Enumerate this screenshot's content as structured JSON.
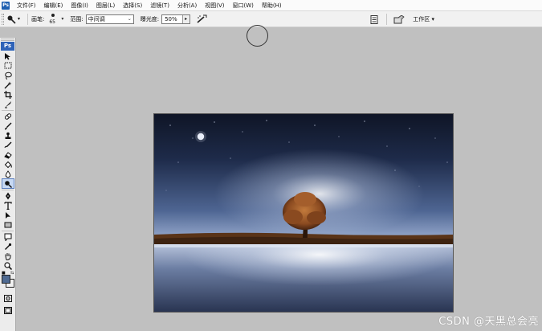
{
  "menubar": {
    "app_icon": "ps-app-icon",
    "items": [
      "文件(F)",
      "编辑(E)",
      "图像(I)",
      "图层(L)",
      "选择(S)",
      "滤镜(T)",
      "分析(A)",
      "视图(V)",
      "窗口(W)",
      "帮助(H)"
    ]
  },
  "options": {
    "brush_label": "画笔:",
    "brush_size": "65",
    "range_label": "范围:",
    "range_value": "中间调",
    "exposure_label": "曝光度:",
    "exposure_value": "50%",
    "workspace_label": "工作区 ▾",
    "active_tool_icon": "dodge-icon"
  },
  "toolbox": {
    "logo": "Ps",
    "tools": [
      "move-icon",
      "marquee-icon",
      "lasso-icon",
      "magic-wand-icon",
      "crop-icon",
      "slice-icon",
      "healing-brush-icon",
      "brush-icon",
      "clone-stamp-icon",
      "history-brush-icon",
      "eraser-icon",
      "paint-bucket-icon",
      "blur-icon",
      "dodge-icon",
      "pen-icon",
      "type-icon",
      "path-selection-icon",
      "rectangle-icon",
      "notes-icon",
      "eyedropper-icon",
      "hand-icon",
      "zoom-icon"
    ],
    "selected_tool": "dodge-icon",
    "foreground_color": "#4f6a92",
    "background_color": "#f2f2f2"
  },
  "canvas_image": {
    "description_icon": "night-tree-photo"
  },
  "watermark": "CSDN @天黑总会亮"
}
